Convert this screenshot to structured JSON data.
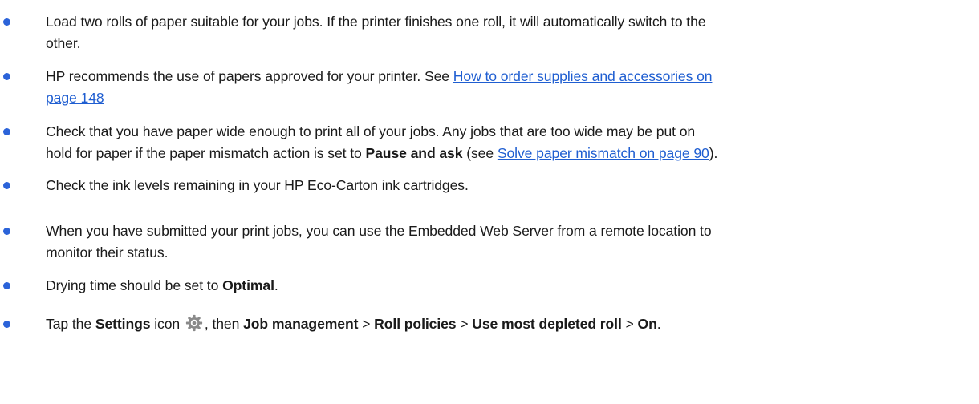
{
  "bullets": [
    {
      "line1": "Load two rolls of paper suitable for your jobs. If the printer finishes one roll, it will automatically switch to the",
      "line2": "other."
    },
    {
      "text": "HP recommends the use of papers approved for your printer. See ",
      "link_part1": "How to order supplies and accessories on",
      "link_part2": "page 148"
    },
    {
      "line1": "Check that you have paper wide enough to print all of your jobs. Any jobs that are too wide may be put on",
      "line2_a": "hold for paper if the paper mismatch action is set to ",
      "bold": "Pause and ask",
      "line2_b": " (see ",
      "link": "Solve paper mismatch on page 90",
      "line2_c": ")."
    },
    {
      "text": "Check the ink levels remaining in your HP Eco-Carton ink cartridges."
    },
    {
      "line1": "When you have submitted your print jobs, you can use the Embedded Web Server from a remote location to",
      "line2": "monitor their status."
    },
    {
      "text": "Drying time should be set to ",
      "bold": "Optimal",
      "end": "."
    },
    {
      "t1": "Tap the ",
      "settings": "Settings",
      "t2": "  icon ",
      "icon": "gear-icon",
      "t3": ", then ",
      "job": "Job management",
      "sep1": " > ",
      "roll": "Roll policies",
      "sep2": " > ",
      "use": "Use most depleted roll",
      "sep3": " > ",
      "on": "On",
      "end": "."
    }
  ],
  "colors": {
    "bullet": "#2b63d9",
    "link": "#1f5ed1",
    "text": "#1a1a1a"
  }
}
